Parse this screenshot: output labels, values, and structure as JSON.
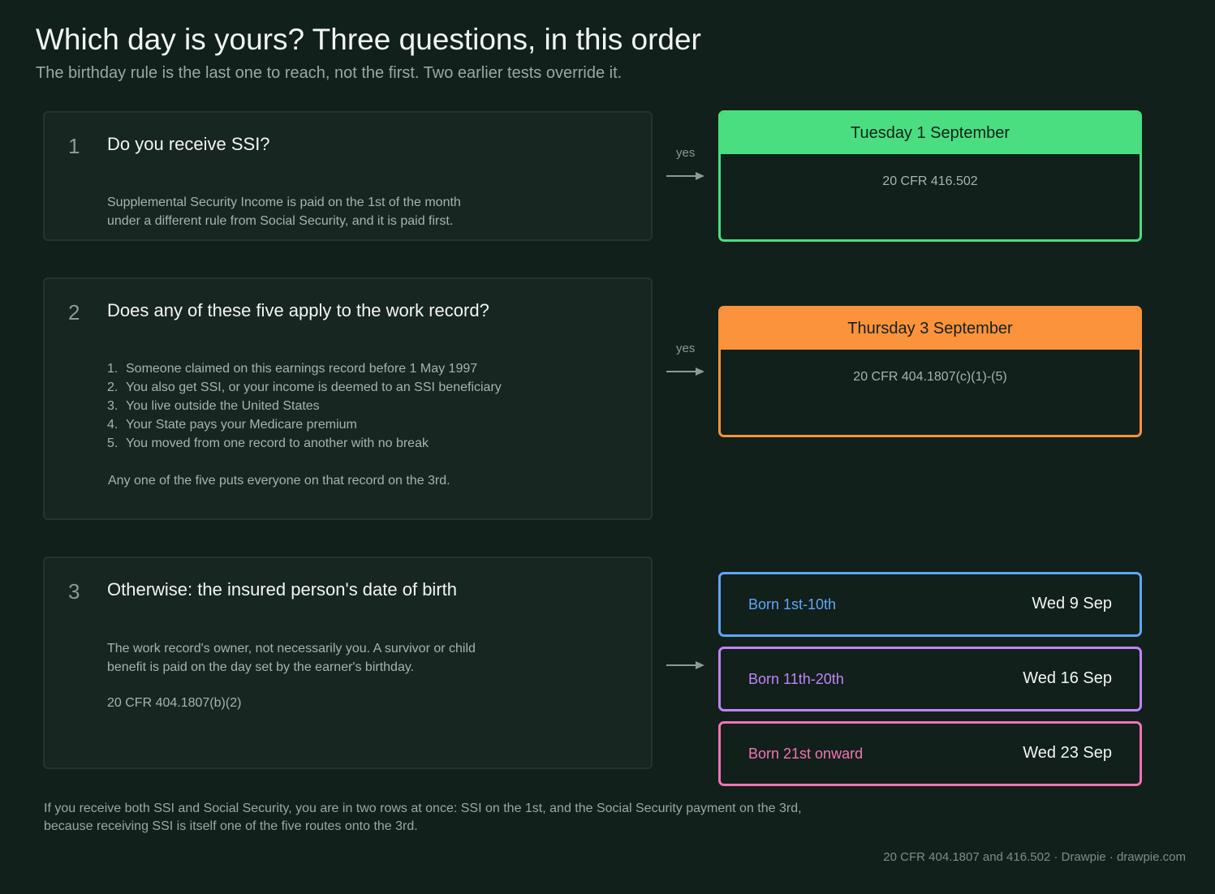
{
  "header": {
    "title": "Which day is yours? Three questions, in this order",
    "subtitle": "The birthday rule is the last one to reach, not the first. Two earlier tests override it."
  },
  "questions": [
    {
      "number": "1",
      "title": "Do you receive SSI?",
      "body": [
        "Supplemental Security Income is paid on the 1st of the month",
        "under a different rule from Social Security, and it is paid first."
      ]
    },
    {
      "number": "2",
      "title": "Does any of these five apply to the work record?",
      "list": [
        "Someone claimed on this earnings record before 1 May 1997",
        "You also get SSI, or your income is deemed to an SSI beneficiary",
        "You live outside the United States",
        "Your State pays your Medicare premium",
        "You moved from one record to another with no break"
      ],
      "note": "Any one of the five puts everyone on that record on the 3rd."
    },
    {
      "number": "3",
      "title": "Otherwise: the insured person's date of birth",
      "body": [
        "The work record's owner, not necessarily you. A survivor or child",
        "benefit is paid on the day set by the earner's birthday."
      ],
      "citation": "20 CFR 404.1807(b)(2)"
    }
  ],
  "arrows": {
    "yes_label": "yes"
  },
  "results": [
    {
      "date": "Tuesday 1 September",
      "citation": "20 CFR 416.502",
      "color": "#4ade80"
    },
    {
      "date": "Thursday 3 September",
      "citation": "20 CFR 404.1807(c)(1)-(5)",
      "color": "#fb923c"
    }
  ],
  "birthday_results": [
    {
      "label": "Born 1st-10th",
      "date": "Wed 9 Sep",
      "color": "#60a5fa"
    },
    {
      "label": "Born 11th-20th",
      "date": "Wed 16 Sep",
      "color": "#c084fc"
    },
    {
      "label": "Born 21st onward",
      "date": "Wed 23 Sep",
      "color": "#f472b6"
    }
  ],
  "footnote": [
    "If you receive both SSI and Social Security, you are in two rows at once: SSI on the 1st, and the Social Security payment on the 3rd,",
    "because receiving SSI is itself one of the five routes onto the 3rd."
  ],
  "credit": "20 CFR 404.1807 and 416.502  ·  Drawpie · drawpie.com"
}
